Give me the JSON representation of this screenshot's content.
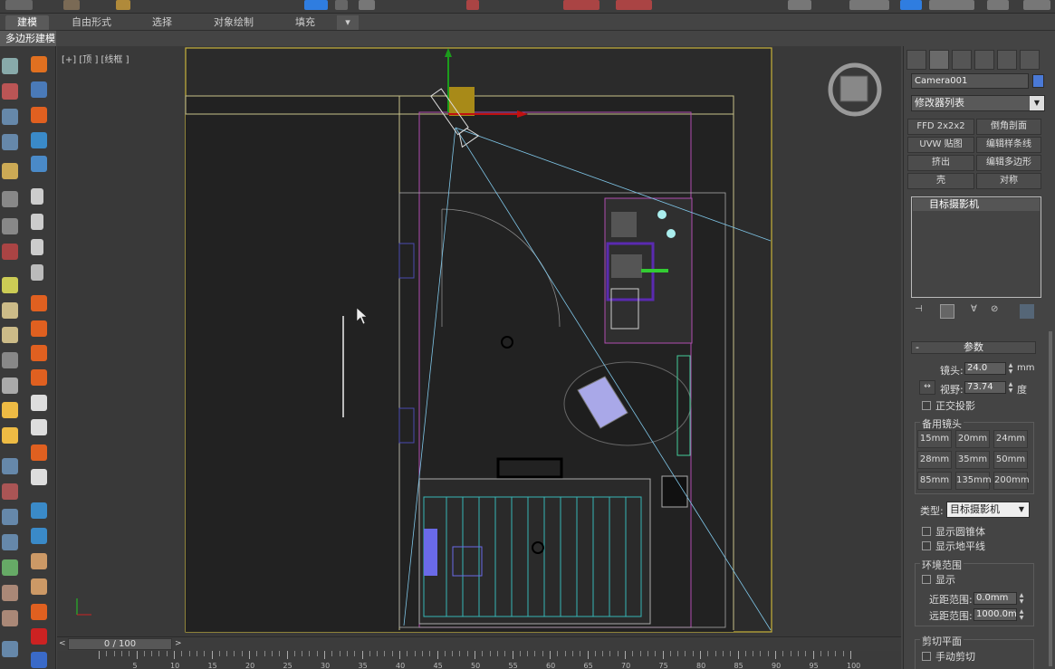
{
  "ribbon": {
    "tabs": [
      "建模",
      "自由形式",
      "选择",
      "对象绘制",
      "填充"
    ],
    "active_tab": "建模",
    "sub_tab": "多边形建模"
  },
  "viewport": {
    "label": "[+] [顶 ] [线框 ]"
  },
  "command_panel": {
    "object_name": "Camera001",
    "object_color": "#4a79d6",
    "modifier_list": "修改器列表",
    "modifier_buttons": [
      "FFD 2x2x2",
      "倒角剖面",
      "UVW 贴图",
      "编辑样条线",
      "挤出",
      "编辑多边形",
      "壳",
      "对称"
    ],
    "stack_item": "目标摄影机",
    "parameters": {
      "title": "参数",
      "lens_label": "镜头:",
      "lens_value": "24.0",
      "lens_unit": "mm",
      "fov_label": "视野:",
      "fov_value": "73.74",
      "fov_unit": "度",
      "ortho_label": "正交投影",
      "stock_lenses_title": "备用镜头",
      "stock_lenses": [
        "15mm",
        "20mm",
        "24mm",
        "28mm",
        "35mm",
        "50mm",
        "85mm",
        "135mm",
        "200mm"
      ],
      "type_label": "类型:",
      "type_value": "目标摄影机",
      "show_cone": "显示圆锥体",
      "show_horizon": "显示地平线",
      "env_range_title": "环境范围",
      "env_show": "显示",
      "near_range_label": "近距范围:",
      "near_range_value": "0.0mm",
      "far_range_label": "远距范围:",
      "far_range_value": "1000.0mm",
      "clipping_title": "剪切平面",
      "manual_clip": "手动剪切"
    }
  },
  "timeline": {
    "frame": "0 / 100",
    "ticks": [
      "5",
      "10",
      "15",
      "20",
      "25",
      "30",
      "35",
      "40",
      "45",
      "50",
      "55",
      "60",
      "65",
      "70",
      "75",
      "80",
      "85",
      "90",
      "95",
      "100"
    ]
  }
}
